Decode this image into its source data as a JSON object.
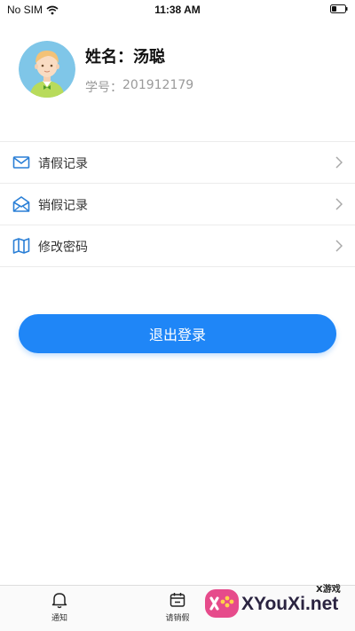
{
  "status_bar": {
    "carrier": "No SIM",
    "time": "11:38 AM"
  },
  "profile": {
    "name_label": "姓名：",
    "name_value": "汤聪",
    "id_label": "学号：",
    "id_value": "201912179"
  },
  "menu": {
    "items": [
      {
        "label": "请假记录",
        "icon": "envelope-icon"
      },
      {
        "label": "销假记录",
        "icon": "open-envelope-icon"
      },
      {
        "label": "修改密码",
        "icon": "map-icon"
      }
    ]
  },
  "logout": {
    "label": "退出登录"
  },
  "tabbar": {
    "tabs": [
      {
        "label": "通知",
        "icon": "bell-icon"
      },
      {
        "label": "请销假",
        "icon": "calendar-icon"
      }
    ]
  },
  "watermark": {
    "text": "XYouXi.net",
    "small": "X游戏"
  },
  "colors": {
    "accent": "#1f86f7",
    "icon": "#2a7fd6",
    "divider": "#ececec"
  }
}
